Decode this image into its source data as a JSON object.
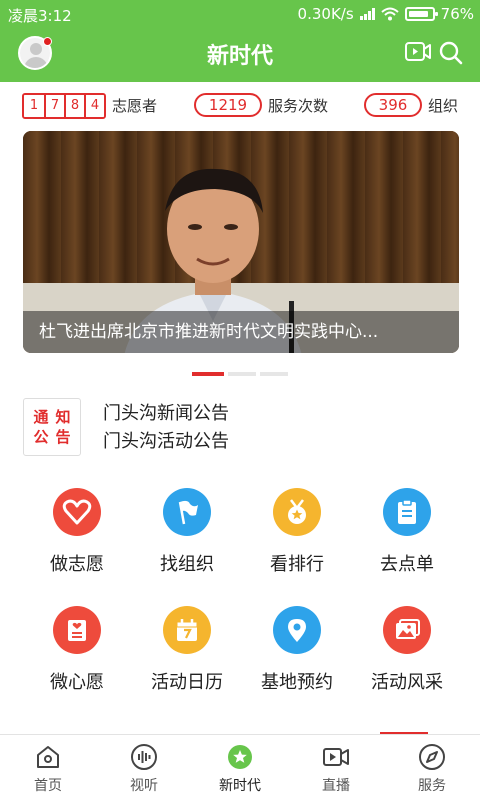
{
  "status_bar": {
    "time": "凌晨3:12",
    "network_speed": "0.30K/s",
    "battery": "76%"
  },
  "header": {
    "title": "新时代"
  },
  "stats": {
    "volunteer_digits": [
      "1",
      "7",
      "8",
      "4"
    ],
    "volunteer_label": "志愿者",
    "service_count": "1219",
    "service_label": "服务次数",
    "org_count": "396",
    "org_label": "组织"
  },
  "banner": {
    "caption": "杜飞进出席北京市推进新时代文明实践中心...",
    "slide_count": 3,
    "active_slide": 1
  },
  "notice": {
    "badge_chars": [
      "通",
      "知",
      "公",
      "告"
    ],
    "lines": [
      "门头沟新闻公告",
      "门头沟活动公告"
    ]
  },
  "grid": {
    "items": [
      {
        "label": "做志愿",
        "icon": "heart-icon",
        "color": "#ee4b3c"
      },
      {
        "label": "找组织",
        "icon": "flag-icon",
        "color": "#2ea3ea"
      },
      {
        "label": "看排行",
        "icon": "medal-icon",
        "color": "#f5b52e"
      },
      {
        "label": "去点单",
        "icon": "clipboard-icon",
        "color": "#2ea3ea"
      },
      {
        "label": "微心愿",
        "icon": "wish-list-icon",
        "color": "#ee4b3c"
      },
      {
        "label": "活动日历",
        "icon": "calendar-icon",
        "color": "#f5b52e"
      },
      {
        "label": "基地预约",
        "icon": "location-pin-icon",
        "color": "#2ea3ea"
      },
      {
        "label": "活动风采",
        "icon": "photo-album-icon",
        "color": "#ee4b3c"
      }
    ]
  },
  "bottom_nav": {
    "items": [
      {
        "label": "首页",
        "icon": "home-icon"
      },
      {
        "label": "视听",
        "icon": "audio-wave-icon"
      },
      {
        "label": "新时代",
        "icon": "star-badge-icon"
      },
      {
        "label": "直播",
        "icon": "live-video-icon"
      },
      {
        "label": "服务",
        "icon": "compass-icon"
      }
    ],
    "active": "新时代"
  },
  "colors": {
    "brand_green": "#67c54b",
    "accent_red": "#e12d2d"
  }
}
